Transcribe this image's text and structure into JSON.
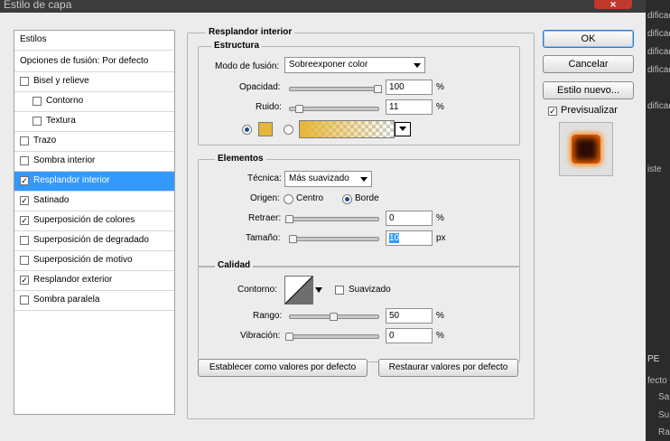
{
  "window": {
    "title": "Estilo de capa"
  },
  "left_panel": {
    "styles_header": "Estilos",
    "blend_options": "Opciones de fusión: Por defecto",
    "items": [
      {
        "label": "Bisel y relieve",
        "checked": false,
        "indent": false
      },
      {
        "label": "Contorno",
        "checked": false,
        "indent": true
      },
      {
        "label": "Textura",
        "checked": false,
        "indent": true
      },
      {
        "label": "Trazo",
        "checked": false,
        "indent": false
      },
      {
        "label": "Sombra interior",
        "checked": false,
        "indent": false
      },
      {
        "label": "Resplandor interior",
        "checked": true,
        "indent": false,
        "selected": true
      },
      {
        "label": "Satinado",
        "checked": true,
        "indent": false
      },
      {
        "label": "Superposición de colores",
        "checked": true,
        "indent": false
      },
      {
        "label": "Superposición de degradado",
        "checked": false,
        "indent": false
      },
      {
        "label": "Superposición de motivo",
        "checked": false,
        "indent": false
      },
      {
        "label": "Resplandor exterior",
        "checked": true,
        "indent": false
      },
      {
        "label": "Sombra paralela",
        "checked": false,
        "indent": false
      }
    ]
  },
  "main": {
    "group_title": "Resplandor interior",
    "structure": {
      "title": "Estructura",
      "blend_mode_label": "Modo de fusión:",
      "blend_mode_value": "Sobreexponer color",
      "opacity_label": "Opacidad:",
      "opacity_value": "100",
      "opacity_level": 1.0,
      "opacity_unit": "%",
      "noise_label": "Ruido:",
      "noise_value": "11",
      "noise_level": 0.11,
      "noise_unit": "%",
      "color": "#e5b737"
    },
    "elements": {
      "title": "Elementos",
      "technique_label": "Técnica:",
      "technique_value": "Más suavizado",
      "origin_label": "Origen:",
      "origin_center": "Centro",
      "origin_edge": "Borde",
      "choke_label": "Retraer:",
      "choke_value": "0",
      "choke_level": 0.0,
      "choke_unit": "%",
      "size_label": "Tamaño:",
      "size_value": "10",
      "size_level": 0.04,
      "size_unit": "px"
    },
    "quality": {
      "title": "Calidad",
      "contour_label": "Contorno:",
      "antialias_label": "Suavizado",
      "range_label": "Rango:",
      "range_value": "50",
      "range_level": 0.5,
      "range_unit": "%",
      "jitter_label": "Vibración:",
      "jitter_value": "0",
      "jitter_level": 0.0,
      "jitter_unit": "%"
    },
    "set_default_button": "Establecer como valores por defecto",
    "reset_default_button": "Restaurar valores por defecto"
  },
  "actions": {
    "ok": "OK",
    "cancel": "Cancelar",
    "new_style": "Estilo nuevo...",
    "preview_label": "Previsualizar",
    "preview_checked": true
  },
  "background_strip": {
    "lines": [
      "dificad",
      "dificad",
      "dificad",
      "dificad",
      "dificad",
      "iste",
      "PE",
      "fecto",
      "Sa",
      "Su",
      "Ra"
    ]
  }
}
